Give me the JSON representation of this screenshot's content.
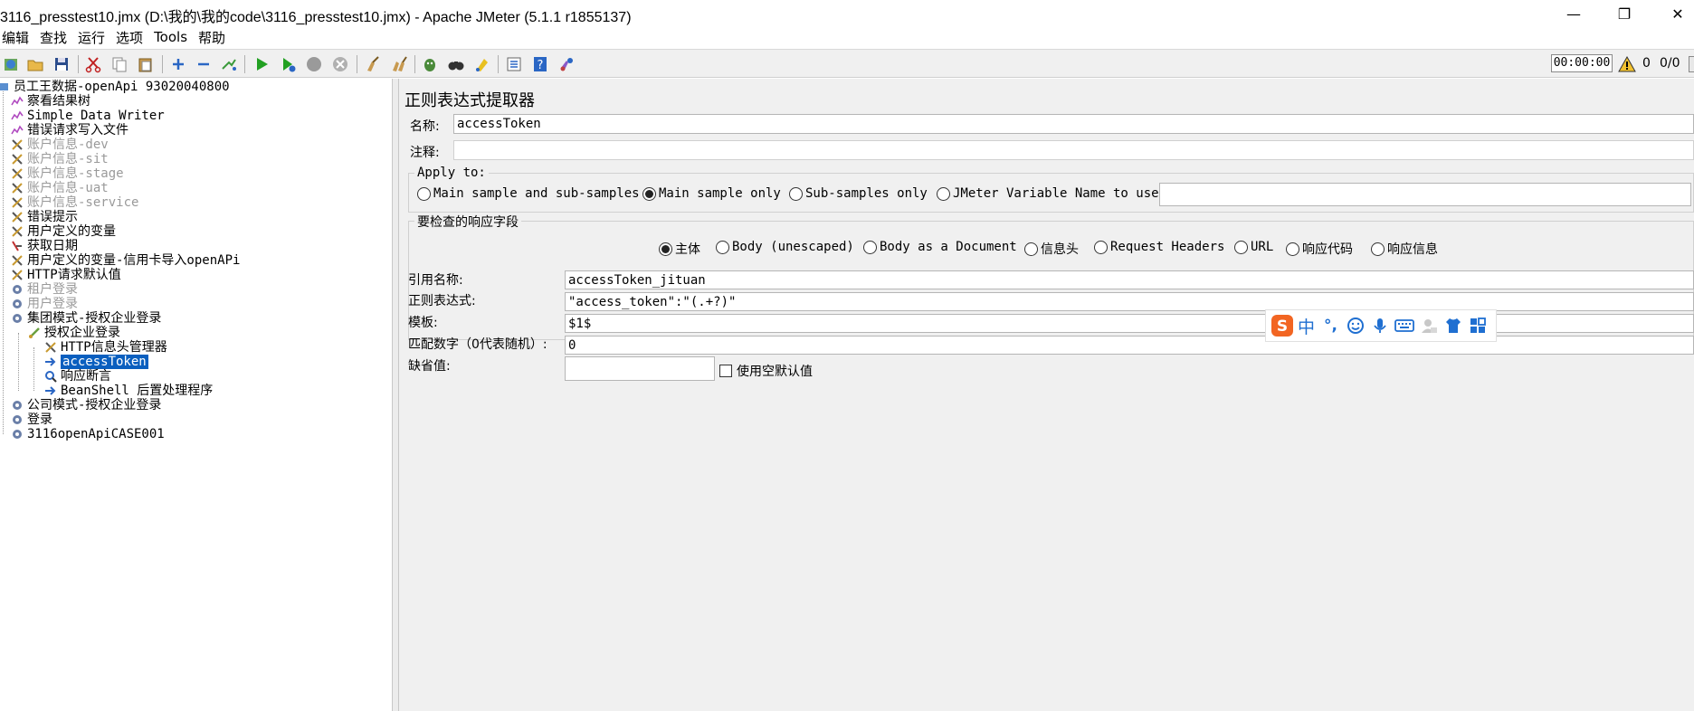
{
  "window": {
    "title": "3116_presstest10.jmx (D:\\我的\\我的code\\3116_presstest10.jmx) - Apache JMeter (5.1.1 r1855137)",
    "minimize_glyph": "—",
    "maximize_glyph": "❐",
    "close_glyph": "✕"
  },
  "menu": [
    "编辑",
    "查找",
    "运行",
    "选项",
    "Tools",
    "帮助"
  ],
  "toolbar": {
    "icons": [
      "templates-icon",
      "open-icon",
      "save-icon",
      "cut-icon",
      "copy-icon",
      "paste-icon",
      "expand-icon",
      "collapse-icon",
      "toggle-icon",
      "start-icon",
      "start-no-pause-icon",
      "stop-icon",
      "shutdown-icon",
      "clear-icon",
      "clear-all-icon",
      "search-icon",
      "reset-search-icon",
      "function-helper-icon",
      "list-icon",
      "help-icon",
      "remote-icon"
    ],
    "timer": "00:00:00",
    "warning_count": "0",
    "threads": "0/0"
  },
  "tree": {
    "nodes": [
      {
        "label": "员工王数据-openApi  93020040800",
        "icon": "testplan-icon",
        "level": 0,
        "disabled": false
      },
      {
        "label": "察看结果树",
        "icon": "listener-icon",
        "level": 1,
        "disabled": false
      },
      {
        "label": "Simple Data Writer",
        "icon": "listener-icon",
        "level": 1,
        "disabled": false
      },
      {
        "label": "错误请求写入文件",
        "icon": "listener-icon",
        "level": 1,
        "disabled": false
      },
      {
        "label": "账户信息-dev",
        "icon": "config-icon",
        "level": 1,
        "disabled": true
      },
      {
        "label": "账户信息-sit",
        "icon": "config-icon",
        "level": 1,
        "disabled": true
      },
      {
        "label": "账户信息-stage",
        "icon": "config-icon",
        "level": 1,
        "disabled": true
      },
      {
        "label": "账户信息-uat",
        "icon": "config-icon",
        "level": 1,
        "disabled": true
      },
      {
        "label": "账户信息-service",
        "icon": "config-icon",
        "level": 1,
        "disabled": true
      },
      {
        "label": "错误提示",
        "icon": "config-icon",
        "level": 1,
        "disabled": false
      },
      {
        "label": "用户定义的变量",
        "icon": "config-icon",
        "level": 1,
        "disabled": false
      },
      {
        "label": "获取日期",
        "icon": "preprocessor-icon",
        "level": 1,
        "disabled": false
      },
      {
        "label": "用户定义的变量-信用卡导入openAPi",
        "icon": "config-icon",
        "level": 1,
        "disabled": false
      },
      {
        "label": "HTTP请求默认值",
        "icon": "config-icon",
        "level": 1,
        "disabled": false
      },
      {
        "label": "租户登录",
        "icon": "threadgroup-icon",
        "level": 1,
        "disabled": true
      },
      {
        "label": "用户登录",
        "icon": "threadgroup-icon",
        "level": 1,
        "disabled": true
      },
      {
        "label": "集团模式-授权企业登录",
        "icon": "threadgroup-icon",
        "level": 1,
        "disabled": false
      },
      {
        "label": "授权企业登录",
        "icon": "sampler-icon",
        "level": 2,
        "disabled": false
      },
      {
        "label": "HTTP信息头管理器",
        "icon": "config-icon",
        "level": 3,
        "disabled": false
      },
      {
        "label": "accessToken",
        "icon": "postprocessor-icon",
        "level": 3,
        "disabled": false,
        "selected": true
      },
      {
        "label": "响应断言",
        "icon": "assertion-icon",
        "level": 3,
        "disabled": false
      },
      {
        "label": "BeanShell 后置处理程序",
        "icon": "postprocessor-icon",
        "level": 3,
        "disabled": false
      },
      {
        "label": "公司模式-授权企业登录",
        "icon": "threadgroup-icon",
        "level": 1,
        "disabled": false
      },
      {
        "label": "登录",
        "icon": "threadgroup-icon",
        "level": 1,
        "disabled": false
      },
      {
        "label": "3116openApiCASE001",
        "icon": "threadgroup-icon",
        "level": 1,
        "disabled": false
      }
    ]
  },
  "panel": {
    "title": "正则表达式提取器",
    "name_label": "名称:",
    "name_value": "accessToken",
    "comment_label": "注释:",
    "comment_value": "",
    "apply_to": {
      "label": "Apply to:",
      "options": [
        "Main sample and sub-samples",
        "Main sample only",
        "Sub-samples only",
        "JMeter Variable Name to use"
      ],
      "selected": 1,
      "variable_value": ""
    },
    "field_to_check": {
      "label": "要检查的响应字段",
      "options": [
        "主体",
        "Body (unescaped)",
        "Body as a Document",
        "信息头",
        "Request Headers",
        "URL",
        "响应代码",
        "响应信息"
      ],
      "selected": 0
    },
    "ref_name_label": "引用名称:",
    "ref_name_value": "accessToken_jituan",
    "regex_label": "正则表达式:",
    "regex_value": "\"access_token\":\"(.+?)\"",
    "template_label": "模板:",
    "template_value": "$1$",
    "match_label": "匹配数字（0代表随机）:",
    "match_value": "0",
    "default_label": "缺省值:",
    "default_value": "",
    "use_empty_default_label": "使用空默认值",
    "use_empty_default_checked": false
  },
  "ime": {
    "items": [
      "sogou-logo-icon",
      "中",
      "°,",
      "emoji-icon",
      "microphone-icon",
      "keyboard-icon",
      "user-icon",
      "shirt-icon",
      "grid-icon"
    ]
  },
  "colors": {
    "selection": "#0a5fbf",
    "panel_bg": "#f0f0f0",
    "disabled_text": "#9a9a9a",
    "ime_accent": "#1f6fd1",
    "sogou_orange": "#f26522"
  }
}
